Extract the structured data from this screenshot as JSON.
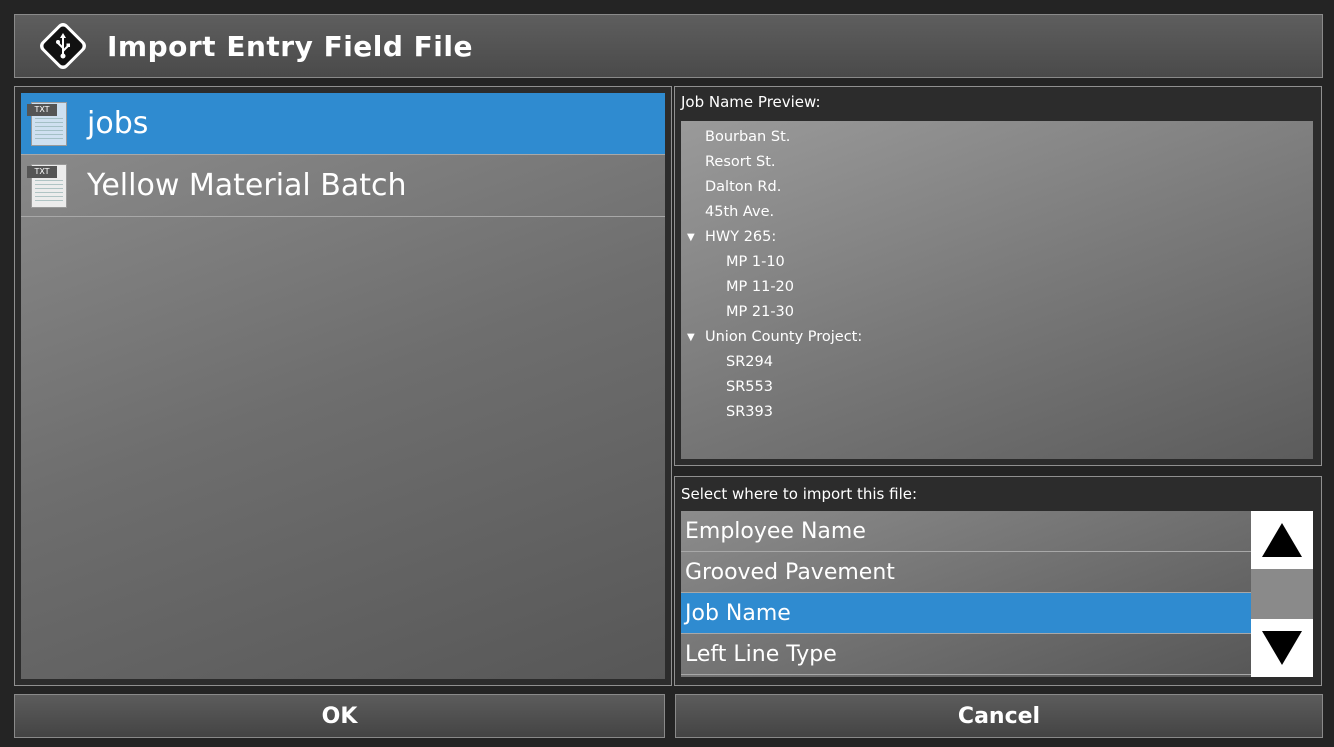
{
  "dialog": {
    "title": "Import Entry Field File",
    "icon": "usb-icon"
  },
  "files": [
    {
      "name": "jobs",
      "type_badge": "TXT",
      "selected": true
    },
    {
      "name": "Yellow Material Batch",
      "type_badge": "TXT",
      "selected": false
    }
  ],
  "preview": {
    "label": "Job Name Preview:",
    "rows": [
      {
        "text": "Bourban St.",
        "level": 0,
        "expandable": false
      },
      {
        "text": "Resort St.",
        "level": 0,
        "expandable": false
      },
      {
        "text": "Dalton Rd.",
        "level": 0,
        "expandable": false
      },
      {
        "text": "45th Ave.",
        "level": 0,
        "expandable": false
      },
      {
        "text": "HWY 265:",
        "level": 0,
        "expandable": true
      },
      {
        "text": "MP 1-10",
        "level": 1,
        "expandable": false
      },
      {
        "text": "MP 11-20",
        "level": 1,
        "expandable": false
      },
      {
        "text": "MP 21-30",
        "level": 1,
        "expandable": false
      },
      {
        "text": "Union County Project:",
        "level": 0,
        "expandable": true
      },
      {
        "text": "SR294",
        "level": 1,
        "expandable": false
      },
      {
        "text": "SR553",
        "level": 1,
        "expandable": false
      },
      {
        "text": "SR393",
        "level": 1,
        "expandable": false
      }
    ]
  },
  "target": {
    "label": "Select where to import this file:",
    "items": [
      {
        "text": "Employee Name",
        "selected": false
      },
      {
        "text": "Grooved Pavement",
        "selected": false
      },
      {
        "text": "Job Name",
        "selected": true
      },
      {
        "text": "Left Line Type",
        "selected": false
      }
    ]
  },
  "buttons": {
    "ok": "OK",
    "cancel": "Cancel"
  },
  "colors": {
    "selection": "#2f8bd0",
    "background": "#242424"
  }
}
